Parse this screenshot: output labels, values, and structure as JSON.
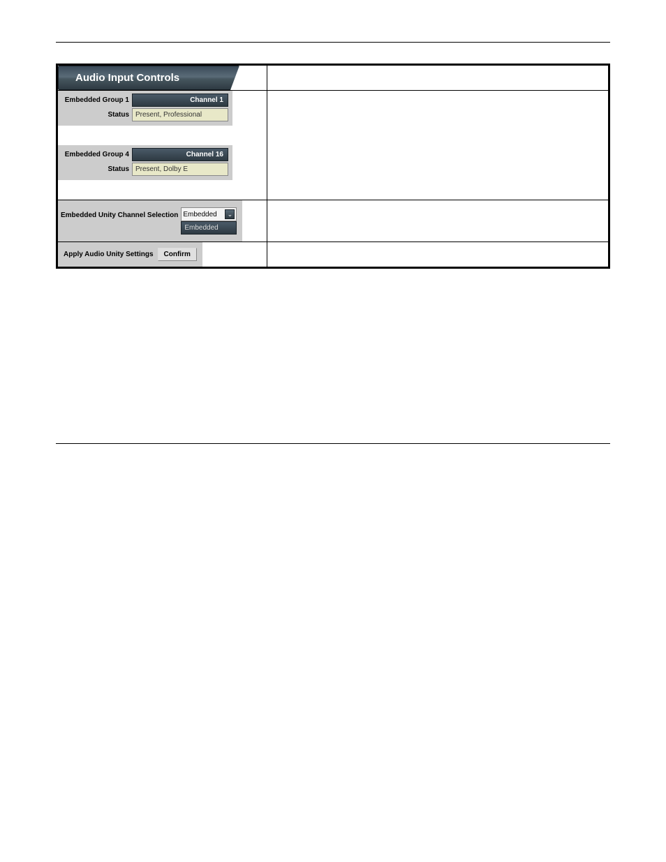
{
  "header": {
    "title": "Audio Input Controls"
  },
  "statusGroups": [
    {
      "groupLabel": "Embedded Group 1",
      "channel": "Channel 1",
      "statusLabel": "Status",
      "statusValue": "Present, Professional"
    },
    {
      "groupLabel": "Embedded Group 4",
      "channel": "Channel 16",
      "statusLabel": "Status",
      "statusValue": "Present, Dolby E"
    }
  ],
  "unitySelection": {
    "label": "Embedded Unity Channel Selection",
    "selected": "Embedded",
    "option": "Embedded"
  },
  "applyUnity": {
    "label": "Apply Audio Unity Settings",
    "button": "Confirm"
  }
}
